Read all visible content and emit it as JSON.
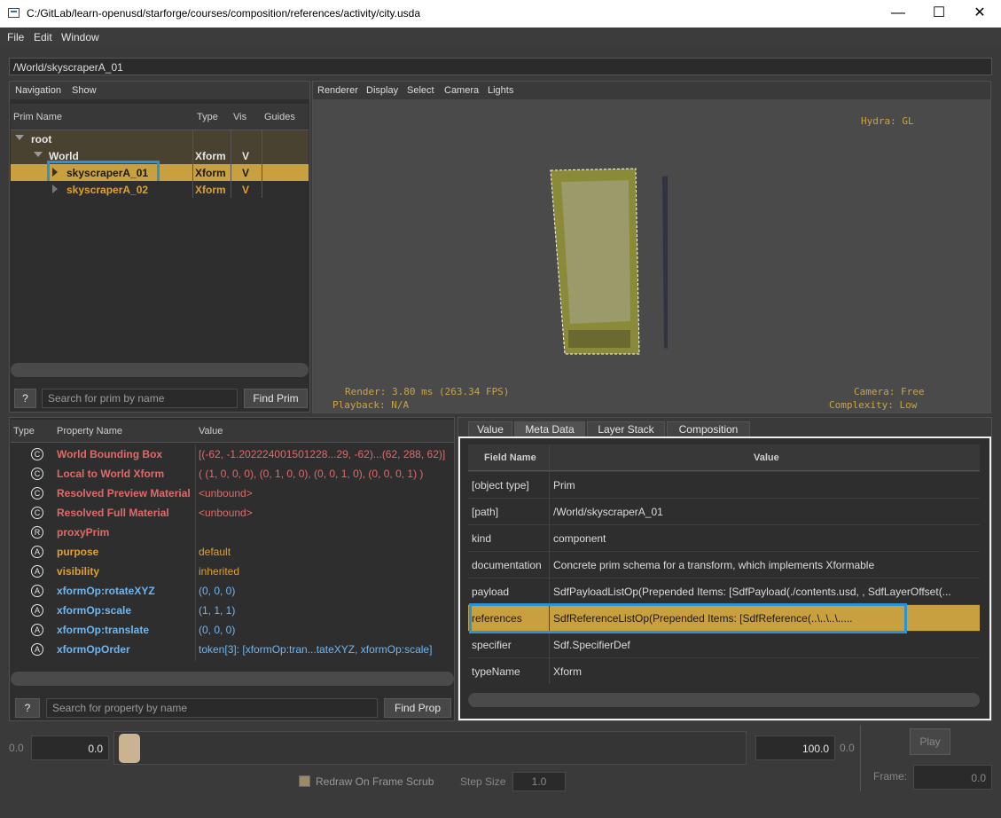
{
  "window": {
    "title": "C:/GitLab/learn-openusd/starforge/courses/composition/references/activity/city.usda",
    "minimize": "—",
    "maximize": "☐",
    "close": "✕"
  },
  "menu": [
    "File",
    "Edit",
    "Window"
  ],
  "path_field": "/World/skyscraperA_01",
  "prim_browser": {
    "menu": [
      "Navigation",
      "Show"
    ],
    "columns": [
      "Prim Name",
      "Type",
      "Vis",
      "Guides"
    ],
    "rows": [
      {
        "name": "root",
        "type": "",
        "vis": ""
      },
      {
        "name": "World",
        "type": "Xform",
        "vis": "V"
      },
      {
        "name": "skyscraperA_01",
        "type": "Xform",
        "vis": "V"
      },
      {
        "name": "skyscraperA_02",
        "type": "Xform",
        "vis": "V"
      }
    ],
    "help_label": "?",
    "search_placeholder": "Search for prim by name",
    "find_label": "Find Prim"
  },
  "viewport": {
    "menu": [
      "Renderer",
      "Display",
      "Select",
      "Camera",
      "Lights"
    ],
    "hydra": "Hydra: GL",
    "render_stats": "Render: 3.80 ms (263.34 FPS)",
    "playback": "Playback: N/A",
    "camera": "Camera: Free",
    "complexity": "Complexity: Low"
  },
  "properties": {
    "columns": [
      "Type",
      "Property Name",
      "Value"
    ],
    "rows": [
      {
        "icon": "C",
        "name": "World Bounding Box",
        "value": "[(-62, -1.202224001501228...29, -62)...(62, 288, 62)]",
        "color": "#e06a6a"
      },
      {
        "icon": "C",
        "name": "Local to World Xform",
        "value": "( (1, 0, 0, 0), (0, 1, 0, 0), (0, 0, 1, 0), (0, 0, 0, 1) )",
        "color": "#e06a6a"
      },
      {
        "icon": "C",
        "name": "Resolved Preview Material",
        "value": "<unbound>",
        "color": "#e06a6a"
      },
      {
        "icon": "C",
        "name": "Resolved Full Material",
        "value": "<unbound>",
        "color": "#e06a6a"
      },
      {
        "icon": "R",
        "name": "proxyPrim",
        "value": "",
        "color": "#e06a6a"
      },
      {
        "icon": "A",
        "name": "purpose",
        "value": "default",
        "color": "#e0a030"
      },
      {
        "icon": "A",
        "name": "visibility",
        "value": "inherited",
        "color": "#e0a030"
      },
      {
        "icon": "A",
        "name": "xformOp:rotateXYZ",
        "value": "(0, 0, 0)",
        "color": "#6fb6ef"
      },
      {
        "icon": "A",
        "name": "xformOp:scale",
        "value": "(1, 1, 1)",
        "color": "#6fb6ef"
      },
      {
        "icon": "A",
        "name": "xformOp:translate",
        "value": "(0, 0, 0)",
        "color": "#6fb6ef"
      },
      {
        "icon": "A",
        "name": "xformOpOrder",
        "value": "token[3]: [xformOp:tran...tateXYZ, xformOp:scale]",
        "color": "#6fb6ef"
      }
    ],
    "help_label": "?",
    "search_placeholder": "Search for property by name",
    "find_label": "Find Prop"
  },
  "metadata": {
    "tabs": [
      "Value",
      "Meta Data",
      "Layer Stack",
      "Composition"
    ],
    "columns": [
      "Field Name",
      "Value"
    ],
    "rows": [
      {
        "field": "[object type]",
        "value": "Prim"
      },
      {
        "field": "[path]",
        "value": "/World/skyscraperA_01"
      },
      {
        "field": "kind",
        "value": "component"
      },
      {
        "field": "documentation",
        "value": "Concrete prim schema for a transform, which implements Xformable"
      },
      {
        "field": "payload",
        "value": "SdfPayloadListOp(Prepended Items: [SdfPayload(./contents.usd, , SdfLayerOffset(..."
      },
      {
        "field": "references",
        "value": "SdfReferenceListOp(Prepended Items: [SdfReference(..\\..\\..\\....."
      },
      {
        "field": "specifier",
        "value": "Sdf.SpecifierDef"
      },
      {
        "field": "typeName",
        "value": "Xform"
      }
    ]
  },
  "timeline": {
    "start_label": "0.0",
    "start_value": "0.0",
    "end_value": "100.0",
    "end_label": "0.0",
    "play": "Play",
    "redraw_label": "Redraw On Frame Scrub",
    "step_label": "Step Size",
    "step_value": "1.0",
    "frame_label": "Frame:",
    "frame_value": "0.0"
  },
  "colors": {
    "selection": "#c8a040",
    "highlight_box": "#2a93d6",
    "prim_text_orange": "#e0a030",
    "viewport_bg": "#4a4a4a"
  }
}
